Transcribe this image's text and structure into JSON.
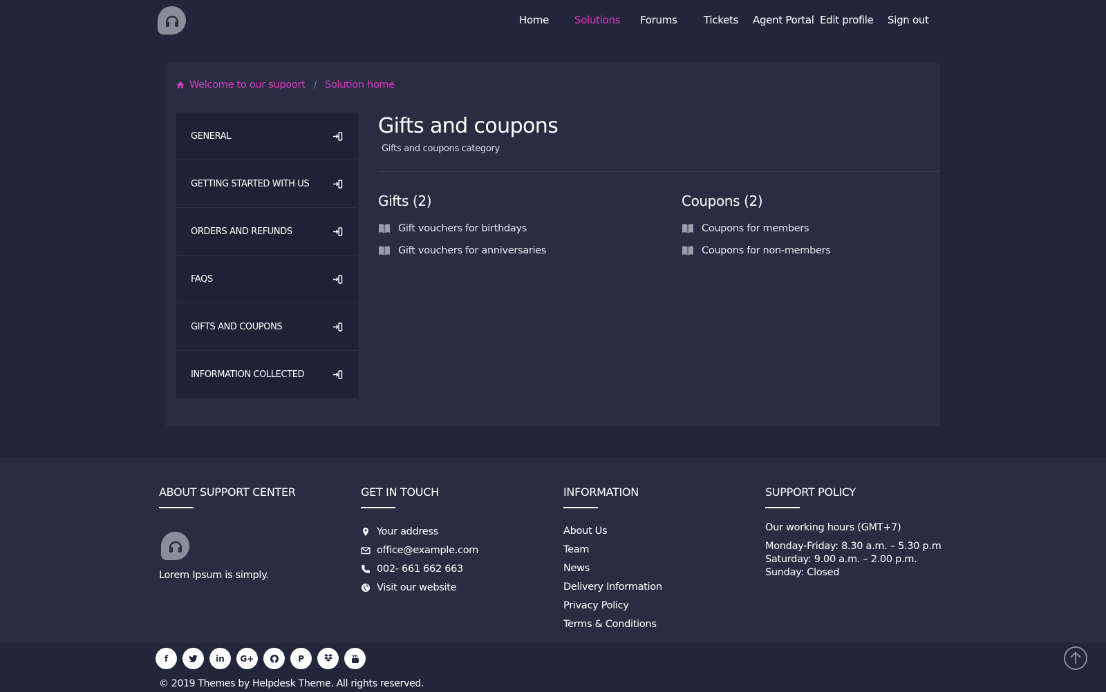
{
  "nav": {
    "home": "Home",
    "solutions": "Solutions",
    "forums": "Forums",
    "tickets": "Tickets",
    "agent_portal": "Agent Portal",
    "edit_profile": "Edit profile",
    "sign_out": "Sign out",
    "active": "Solutions"
  },
  "breadcrumb": {
    "home_label": "Welcome to our supoort",
    "separator": "/",
    "current": "Solution home"
  },
  "sidebar": {
    "items": [
      {
        "label": "GENERAL"
      },
      {
        "label": "GETTING STARTED WITH US"
      },
      {
        "label": "ORDERS AND REFUNDS"
      },
      {
        "label": "FAQS"
      },
      {
        "label": "GIFTS AND COUPONS"
      },
      {
        "label": "INFORMATION COLLECTED"
      }
    ]
  },
  "main": {
    "title": "Gifts and coupons",
    "subtitle": "Gifts and coupons category",
    "sections": [
      {
        "name": "Gifts",
        "count": "(2)",
        "articles": [
          "Gift vouchers for birthdays",
          "Gift vouchers for anniversaries"
        ]
      },
      {
        "name": "Coupons",
        "count": "(2)",
        "articles": [
          "Coupons for members",
          "Coupons for non-members"
        ]
      }
    ]
  },
  "footer": {
    "about": {
      "heading": "ABOUT SUPPORT CENTER",
      "text": "Lorem Ipsum is simply."
    },
    "contact": {
      "heading": "GET IN TOUCH",
      "address": "Your address",
      "email": "office@example.com",
      "phone": "002- 661 662 663",
      "website": "Visit our website"
    },
    "information": {
      "heading": "INFORMATION",
      "links": [
        "About Us",
        "Team",
        "News",
        "Delivery Information",
        "Privacy Policy",
        "Terms & Conditions"
      ]
    },
    "policy": {
      "heading": "SUPPORT POLICY",
      "hours_title": "Our working hours (GMT+7)",
      "weekdays": "Monday-Friday: 8.30 a.m. – 5.30 p.m",
      "saturday": "Saturday: 9.00 a.m. – 2.00 p.m.",
      "sunday": "Sunday: Closed"
    },
    "social_icons": [
      "facebook-icon",
      "twitter-icon",
      "linkedin-icon",
      "google-plus-icon",
      "github-icon",
      "pinterest-icon",
      "dropbox-icon",
      "youtube-icon"
    ],
    "copyright": "© 2019 Themes by Helpdesk Theme. All rights reserved."
  },
  "colors": {
    "accent": "#d63bc2",
    "background": "#22263a",
    "panel": "#292d42",
    "sidebar": "#1f2235"
  }
}
